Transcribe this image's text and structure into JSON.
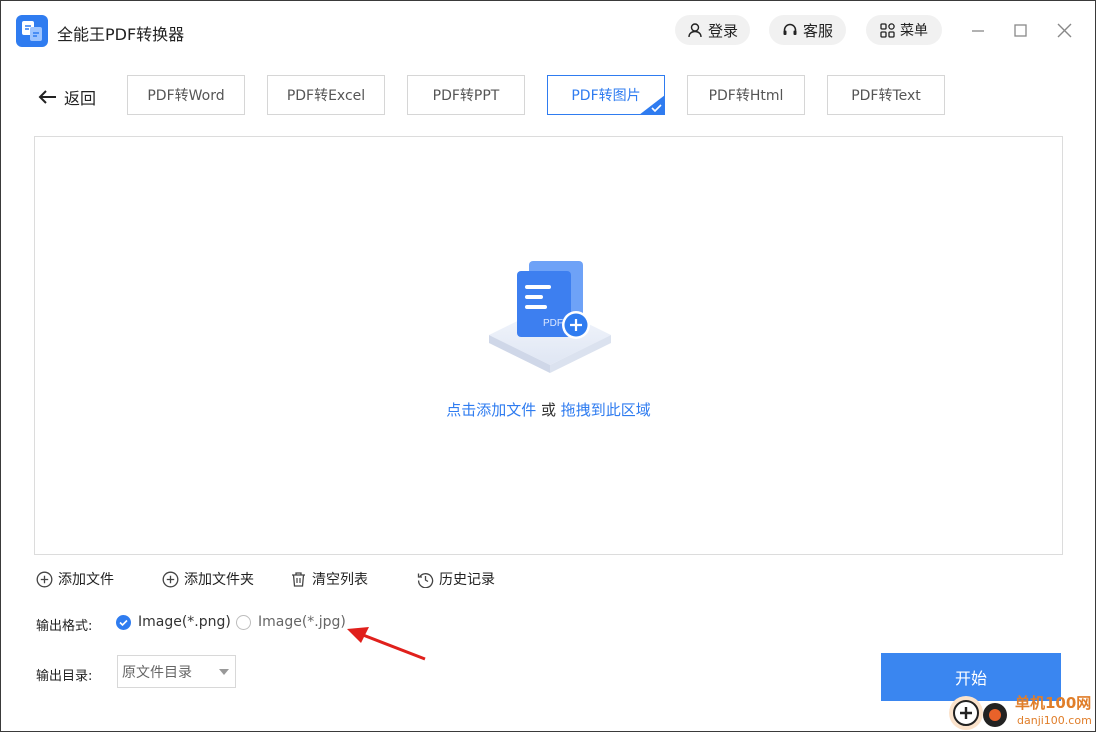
{
  "app": {
    "title": "全能王PDF转换器"
  },
  "titlebar": {
    "login_label": "登录",
    "service_label": "客服",
    "menu_label": "菜单"
  },
  "nav": {
    "back_label": "返回"
  },
  "tabs": [
    {
      "label": "PDF转Word",
      "active": false
    },
    {
      "label": "PDF转Excel",
      "active": false
    },
    {
      "label": "PDF转PPT",
      "active": false
    },
    {
      "label": "PDF转图片",
      "active": true
    },
    {
      "label": "PDF转Html",
      "active": false
    },
    {
      "label": "PDF转Text",
      "active": false
    }
  ],
  "dropzone": {
    "icon_label": "PDF",
    "add_link": "点击添加文件",
    "or_text": " 或 ",
    "drag_link": "拖拽到此区域"
  },
  "actions": {
    "add_file": "添加文件",
    "add_folder": "添加文件夹",
    "clear_list": "清空列表",
    "history": "历史记录"
  },
  "output": {
    "format_label": "输出格式:",
    "format_options": [
      {
        "label": "Image(*.png)",
        "checked": true
      },
      {
        "label": "Image(*.jpg)",
        "checked": false
      }
    ],
    "dir_label": "输出目录:",
    "dir_value": "原文件目录"
  },
  "start_label": "开始",
  "watermark": {
    "line1": "单机100网",
    "line2": "danji100.com"
  },
  "colors": {
    "accent": "#2f7cf0",
    "start_button": "#3a86f0",
    "annotation_arrow": "#e0201c"
  }
}
